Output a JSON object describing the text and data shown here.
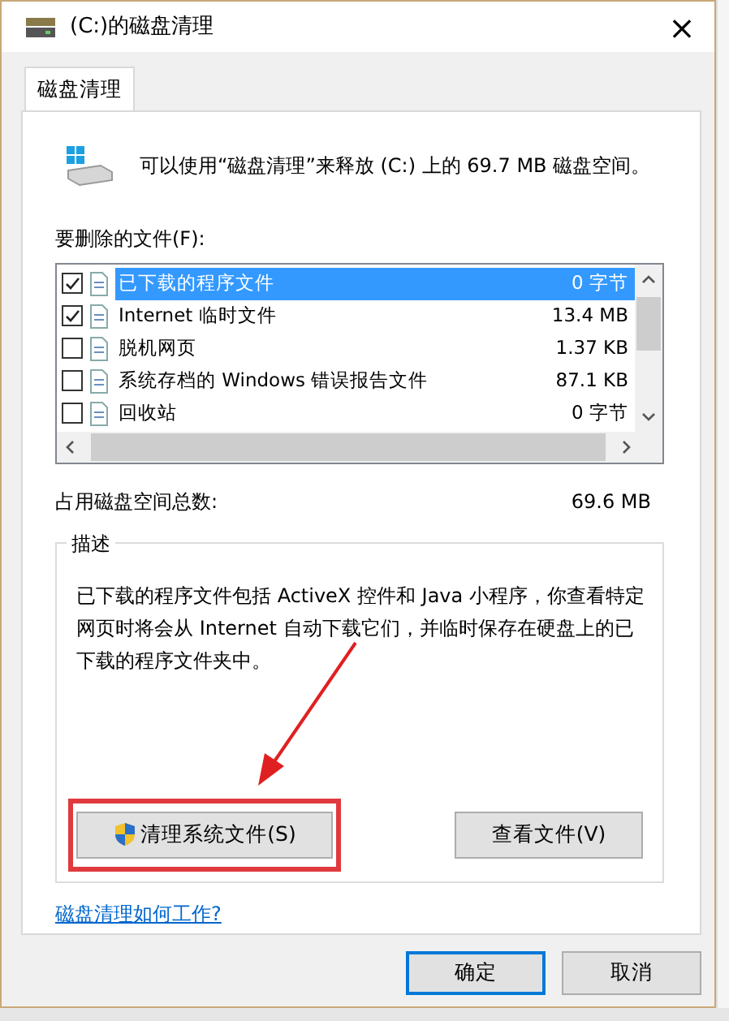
{
  "window": {
    "title": "(C:)的磁盘清理",
    "close": "×"
  },
  "tabs": [
    {
      "label": "磁盘清理",
      "selected": true
    }
  ],
  "summary": "可以使用“磁盘清理”来释放 (C:) 上的 69.7 MB 磁盘空间。",
  "files_label": "要删除的文件(F):",
  "files": [
    {
      "name": "已下载的程序文件",
      "size": "0 字节",
      "checked": true,
      "selected": true
    },
    {
      "name": "Internet 临时文件",
      "size": "13.4 MB",
      "checked": true,
      "selected": false
    },
    {
      "name": "脱机网页",
      "size": "1.37 KB",
      "checked": false,
      "selected": false
    },
    {
      "name": "系统存档的 Windows 错误报告文件",
      "size": "87.1 KB",
      "checked": false,
      "selected": false
    },
    {
      "name": "回收站",
      "size": "0 字节",
      "checked": false,
      "selected": false
    }
  ],
  "total": {
    "label": "占用磁盘空间总数:",
    "value": "69.6 MB"
  },
  "description": {
    "legend": "描述",
    "text": "已下载的程序文件包括 ActiveX 控件和 Java 小程序，你查看特定网页时将会从 Internet 自动下载它们，并临时保存在硬盘上的已下载的程序文件夹中。"
  },
  "actions": [
    {
      "label": "清理系统文件(S)",
      "shield": true,
      "highlighted": true
    },
    {
      "label": "查看文件(V)",
      "shield": false,
      "highlighted": false
    }
  ],
  "help_link": "磁盘清理如何工作?",
  "buttons": [
    {
      "label": "确定",
      "default": true
    },
    {
      "label": "取消",
      "default": false
    }
  ]
}
